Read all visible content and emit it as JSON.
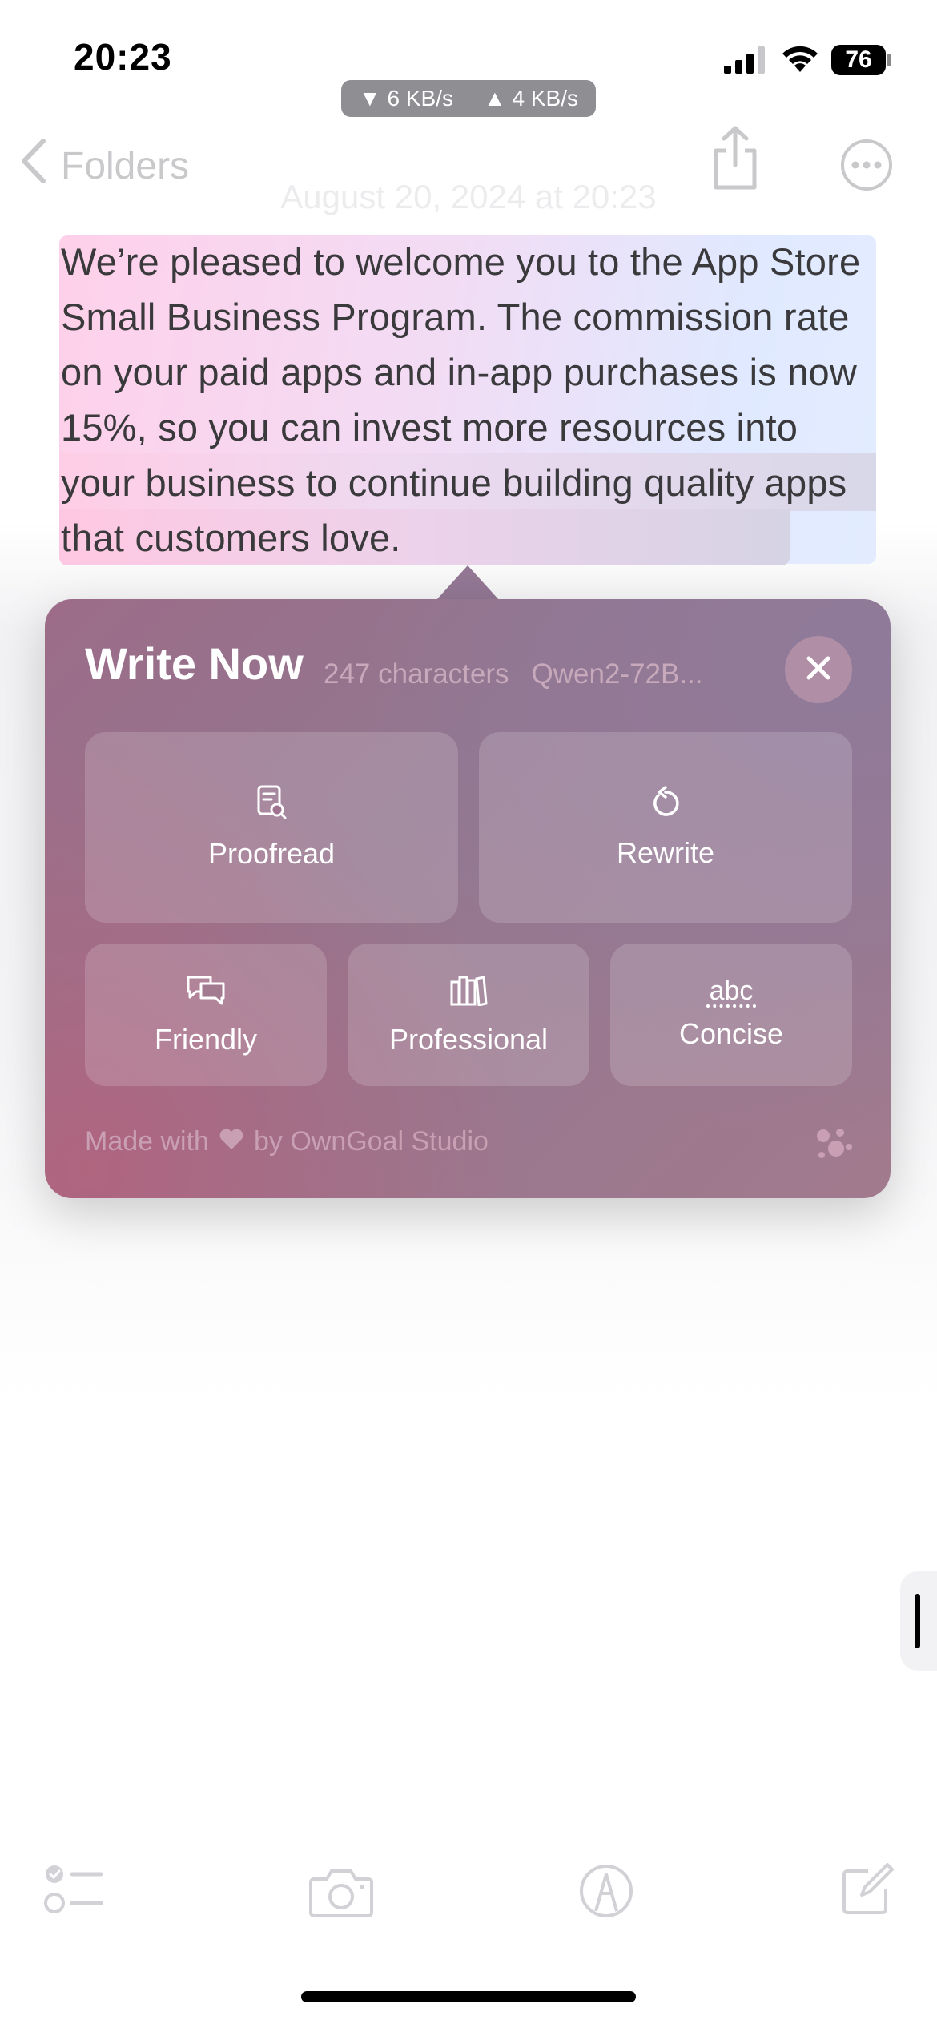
{
  "status_bar": {
    "time": "20:23",
    "download_speed": "6 KB/s",
    "upload_speed": "4 KB/s",
    "battery": "76"
  },
  "nav": {
    "back_label": "Folders",
    "date": "August 20, 2024 at 20:23"
  },
  "note": {
    "selected_text": "We’re pleased to welcome you to the App Store Small Business Program. The commission rate on your paid apps and in-app purchases is now 15%, so you can invest more resources into your business to continue building quality apps that customers love."
  },
  "panel": {
    "title": "Write Now",
    "char_count": "247 characters",
    "model": "Qwen2-72B...",
    "actions": [
      {
        "label": "Proofread",
        "icon": "proofread-icon"
      },
      {
        "label": "Rewrite",
        "icon": "rewrite-icon"
      },
      {
        "label": "Friendly",
        "icon": "chat-bubbles-icon"
      },
      {
        "label": "Professional",
        "icon": "books-icon"
      },
      {
        "label": "Concise",
        "icon": "abc-icon"
      }
    ],
    "concise_icon_text": "abc",
    "footer_prefix": "Made with",
    "footer_suffix": "by OwnGoal Studio"
  },
  "colors": {
    "panel_bg": "#9a7088",
    "selection_pink": "#ffd0ea",
    "selection_blue": "#e0e9ff"
  }
}
